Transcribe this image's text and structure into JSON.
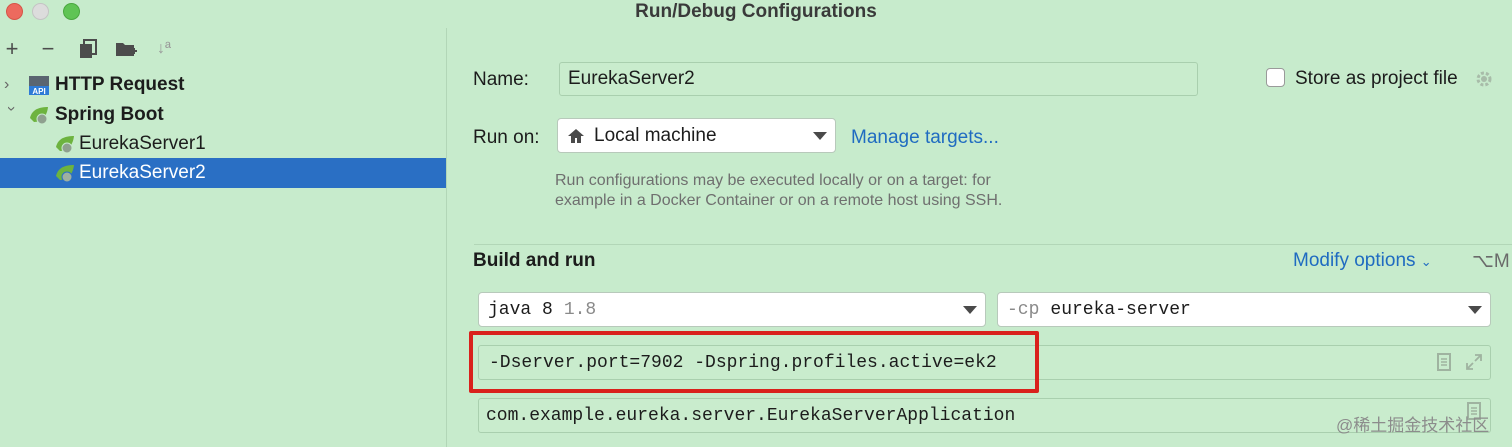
{
  "window": {
    "title": "Run/Debug Configurations"
  },
  "toolbar": {
    "add": "+",
    "remove": "−",
    "sort": "↓ª"
  },
  "tree": {
    "items": [
      {
        "label": "HTTP Request",
        "level": 0,
        "expanded": false,
        "icon": "api-icon"
      },
      {
        "label": "Spring Boot",
        "level": 0,
        "expanded": true,
        "icon": "spring-boot-icon"
      },
      {
        "label": "EurekaServer1",
        "level": 1,
        "icon": "spring-boot-run-icon"
      },
      {
        "label": "EurekaServer2",
        "level": 1,
        "icon": "spring-boot-run-icon",
        "selected": true
      }
    ],
    "api_badge": "API"
  },
  "form": {
    "name_label": "Name:",
    "name_value": "EurekaServer2",
    "store_label": "Store as project file",
    "store_checked": false,
    "run_on_label": "Run on:",
    "run_on_value": "Local machine",
    "manage_targets": "Manage targets...",
    "hint_line1": "Run configurations may be executed locally or on a target: for",
    "hint_line2": "example in a Docker Container or on a remote host using SSH.",
    "section_title": "Build and run",
    "modify_options": "Modify options",
    "modify_shortcut": "⌥M",
    "jre_main": "java 8",
    "jre_version": "1.8",
    "cp_prefix": "-cp",
    "cp_value": "eureka-server",
    "vm_options": "-Dserver.port=7902 -Dspring.profiles.active=ek2",
    "main_class": "com.example.eureka.server.EurekaServerApplication"
  },
  "watermark": "@稀土掘金技术社区",
  "colors": {
    "background": "#c7ebcc",
    "selection": "#2a6fc4",
    "link": "#1f6bc1",
    "highlight": "#d9211c"
  }
}
